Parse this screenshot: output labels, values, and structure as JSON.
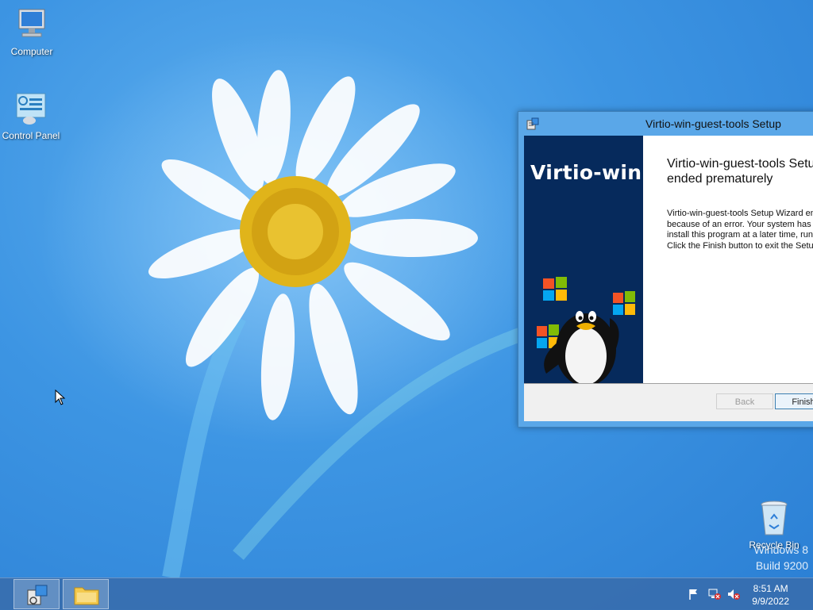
{
  "desktop": {
    "icons": [
      {
        "label": "Computer"
      },
      {
        "label": "Control Panel"
      },
      {
        "label": "Recycle Bin"
      }
    ],
    "watermark": {
      "line1": "Windows 8",
      "line2": "Build 9200"
    }
  },
  "dialog": {
    "title": "Virtio-win-guest-tools Setup",
    "banner_title": "Virtio-win",
    "heading": "Virtio-win-guest-tools Setup Wizard\nended prematurely",
    "message": "Virtio-win-guest-tools Setup Wizard ended prematurely\nbecause of an error. Your system has not been modified. To\ninstall this program at a later time, run Setup Wizard again.\nClick the Finish button to exit the Setup Wizard.",
    "back_label": "Back",
    "finish_label": "Finish"
  },
  "taskbar": {
    "time": "8:51 AM",
    "date": "9/9/2022"
  },
  "colors": {
    "desktop": "#3d95e3",
    "taskbar": "#376eaf",
    "banner": "#062a5c",
    "title_bar": "#5aa7e8"
  }
}
